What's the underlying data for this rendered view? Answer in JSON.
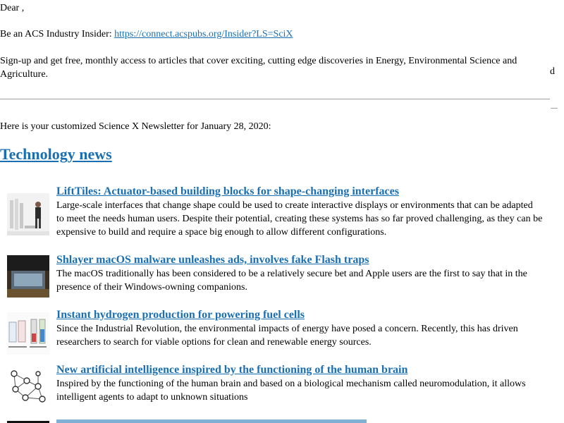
{
  "greeting": "Dear ,",
  "promo": {
    "lead": "Be an ACS Industry Insider: ",
    "link": "https://connect.acspubs.org/Insider?LS=SciX",
    "body_line1": "Sign-up and get free, monthly access to articles that cover exciting, cutting edge discoveries in Energy, Environmental Science and",
    "body_line2": "Agriculture.",
    "stray_char": "d"
  },
  "intro": "Here is your customized Science X Newsletter for January 28, 2020:",
  "section": {
    "title": "Technology news"
  },
  "articles": [
    {
      "title": "LiftTiles: Actuator-based building blocks for shape-changing interfaces",
      "desc": "Large-scale interfaces that change shape could be used to create interactive displays or environments that can be adapted to meet the needs human users. Despite their potential, creating these systems has so far proved challenging, as they can be expensive to build and require a space big enough to allow different configurations."
    },
    {
      "title": "Shlayer macOS malware unleashes ads, involves fake Flash traps",
      "desc": "The macOS traditionally has been considered to be a relatively secure bet and Apple users are the first to say that in the presence of their Windows-owning companions."
    },
    {
      "title": "Instant hydrogen production for powering fuel cells",
      "desc": "Since the Industrial Revolution, the environmental impacts of energy have posed a concern. Recently, this has driven researchers to search for viable options for clean and renewable energy sources."
    },
    {
      "title": "New artificial intelligence inspired by the functioning of the human brain",
      "desc": "Inspired by the functioning of the human brain and based on a biological mechanism called neuromodulation, it allows intelligent agents to adapt to unknown situations"
    }
  ],
  "colors": {
    "link": "#1a6fb3",
    "rule": "#a0a0a0"
  }
}
